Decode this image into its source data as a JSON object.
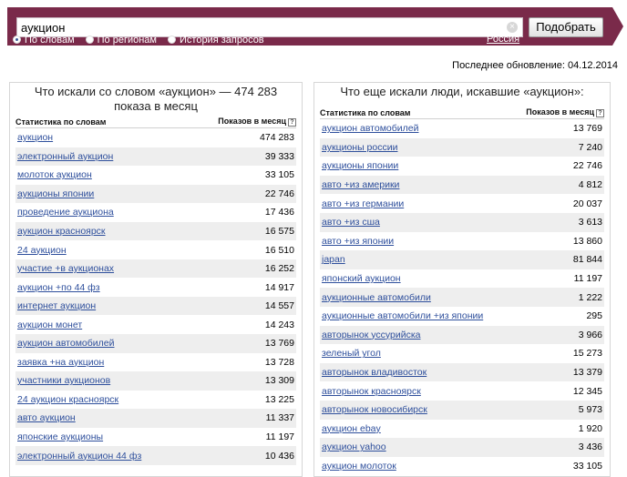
{
  "search": {
    "value": "аукцион",
    "button_label": "Подобрать"
  },
  "modes": [
    {
      "label": "По словам",
      "checked": true
    },
    {
      "label": "По регионам",
      "checked": false
    },
    {
      "label": "История запросов",
      "checked": false
    }
  ],
  "region": "Россия",
  "updated": "Последнее обновление: 04.12.2014",
  "left": {
    "title": "Что искали со словом «аукцион» — 474 283 показа в месяц",
    "col_query": "Статистика по словам",
    "col_count": "Показов в месяц",
    "rows": [
      {
        "q": "аукцион",
        "n": "474 283"
      },
      {
        "q": "электронный аукцион",
        "n": "39 333"
      },
      {
        "q": "молоток аукцион",
        "n": "33 105"
      },
      {
        "q": "аукционы японии",
        "n": "22 746"
      },
      {
        "q": "проведение аукциона",
        "n": "17 436"
      },
      {
        "q": "аукцион красноярск",
        "n": "16 575"
      },
      {
        "q": "24 аукцион",
        "n": "16 510"
      },
      {
        "q": "участие +в аукционах",
        "n": "16 252"
      },
      {
        "q": "аукцион +по 44 фз",
        "n": "14 917"
      },
      {
        "q": "интернет аукцион",
        "n": "14 557"
      },
      {
        "q": "аукцион монет",
        "n": "14 243"
      },
      {
        "q": "аукцион автомобилей",
        "n": "13 769"
      },
      {
        "q": "заявка +на аукцион",
        "n": "13 728"
      },
      {
        "q": "участники аукционов",
        "n": "13 309"
      },
      {
        "q": "24 аукцион красноярск",
        "n": "13 225"
      },
      {
        "q": "авто аукцион",
        "n": "11 337"
      },
      {
        "q": "японские аукционы",
        "n": "11 197"
      },
      {
        "q": "электронный аукцион 44 фз",
        "n": "10 436"
      }
    ]
  },
  "right": {
    "title": "Что еще искали люди, искавшие «аукцион»:",
    "col_query": "Статистика по словам",
    "col_count": "Показов в месяц",
    "rows": [
      {
        "q": "аукцион автомобилей",
        "n": "13 769"
      },
      {
        "q": "аукционы россии",
        "n": "7 240"
      },
      {
        "q": "аукционы японии",
        "n": "22 746"
      },
      {
        "q": "авто +из америки",
        "n": "4 812"
      },
      {
        "q": "авто +из германии",
        "n": "20 037"
      },
      {
        "q": "авто +из сша",
        "n": "3 613"
      },
      {
        "q": "авто +из японии",
        "n": "13 860"
      },
      {
        "q": "japan",
        "n": "81 844"
      },
      {
        "q": "японский аукцион",
        "n": "11 197"
      },
      {
        "q": "аукционные автомобили",
        "n": "1 222"
      },
      {
        "q": "аукционные автомобили +из японии",
        "n": "295"
      },
      {
        "q": "авторынок уссурийска",
        "n": "3 966"
      },
      {
        "q": "зеленый угол",
        "n": "15 273"
      },
      {
        "q": "авторынок владивосток",
        "n": "13 379"
      },
      {
        "q": "авторынок красноярск",
        "n": "12 345"
      },
      {
        "q": "авторынок новосибирск",
        "n": "5 973"
      },
      {
        "q": "аукцион ebay",
        "n": "1 920"
      },
      {
        "q": "аукцион yahoo",
        "n": "3 436"
      },
      {
        "q": "аукцион молоток",
        "n": "33 105"
      }
    ]
  },
  "icons": {
    "clear": "clear-icon",
    "help": "question-icon"
  },
  "colors": {
    "band": "#7a2a4a",
    "link": "#2e4f9c",
    "stripe": "#eeeeee"
  }
}
